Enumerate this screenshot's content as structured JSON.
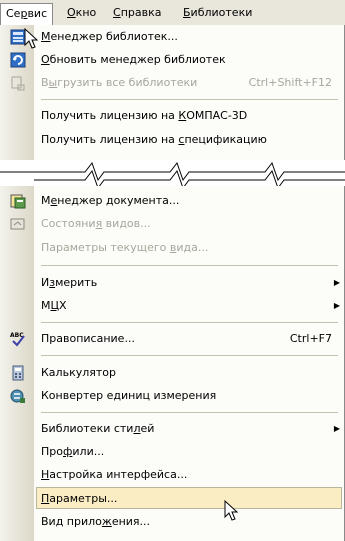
{
  "menubar": {
    "service": {
      "pre": "Се",
      "u": "р",
      "post": "вис"
    },
    "window": {
      "pre": "",
      "u": "О",
      "post": "кно"
    },
    "help": {
      "pre": "",
      "u": "С",
      "post": "правка"
    },
    "libraries": {
      "pre": "",
      "u": "Б",
      "post": "иблиотеки"
    }
  },
  "menu_top": {
    "lib_manager": {
      "pre": "",
      "u": "М",
      "post": "енеджер библиотек...",
      "icon": "library-manager-icon"
    },
    "update_lib": {
      "pre": "",
      "u": "О",
      "post": "бновить менеджер библиотек",
      "icon": "refresh-library-icon"
    },
    "unload_all": {
      "pre": "В",
      "u": "ы",
      "post": "грузить все библиотеки",
      "shortcut": "Ctrl+Shift+F12",
      "icon": "unload-libraries-icon"
    },
    "license_kompas": {
      "pre": "Получить лицензию на ",
      "u": "К",
      "post": "ОМПАС-3D"
    },
    "license_spec": {
      "pre": "Получить лицензию на ",
      "u": "с",
      "post": "пецификацию"
    }
  },
  "menu_bottom": {
    "doc_manager": {
      "pre": "М",
      "u": "е",
      "post": "неджер документа...",
      "icon": "document-manager-icon"
    },
    "view_state": {
      "pre": "Состояни",
      "u": "я",
      "post": " видов...",
      "icon": "view-state-icon"
    },
    "view_params": {
      "pre": "Параметры текущего ",
      "u": "в",
      "post": "ида..."
    },
    "measure": {
      "pre": "И",
      "u": "з",
      "post": "мерить"
    },
    "mcx": {
      "pre": "М",
      "u": "Ц",
      "post": "Х"
    },
    "spelling": {
      "pre": "Правописание...",
      "u": "",
      "post": "",
      "shortcut": "Ctrl+F7",
      "icon": "spellcheck-icon"
    },
    "calculator": {
      "pre": "Калькулятор",
      "u": "",
      "post": "",
      "icon": "calculator-icon"
    },
    "unit_converter": {
      "pre": "Конвертер единиц измерения",
      "u": "",
      "post": "",
      "icon": "unit-converter-icon"
    },
    "style_libs": {
      "pre": "Библиотеки сти",
      "u": "л",
      "post": "ей"
    },
    "profiles": {
      "pre": "Про",
      "u": "ф",
      "post": "или..."
    },
    "ui_settings": {
      "pre": "",
      "u": "Н",
      "post": "астройка интерфейса..."
    },
    "parameters": {
      "pre": "",
      "u": "П",
      "post": "араметры..."
    },
    "app_view": {
      "pre": "Вид прило",
      "u": "ж",
      "post": "ения..."
    }
  },
  "colors": {
    "menubar_bg": "#e9e6dc",
    "menu_bg": "#fcfcf9",
    "selected_bg": "#faecc3",
    "disabled_text": "#a7a69c"
  }
}
